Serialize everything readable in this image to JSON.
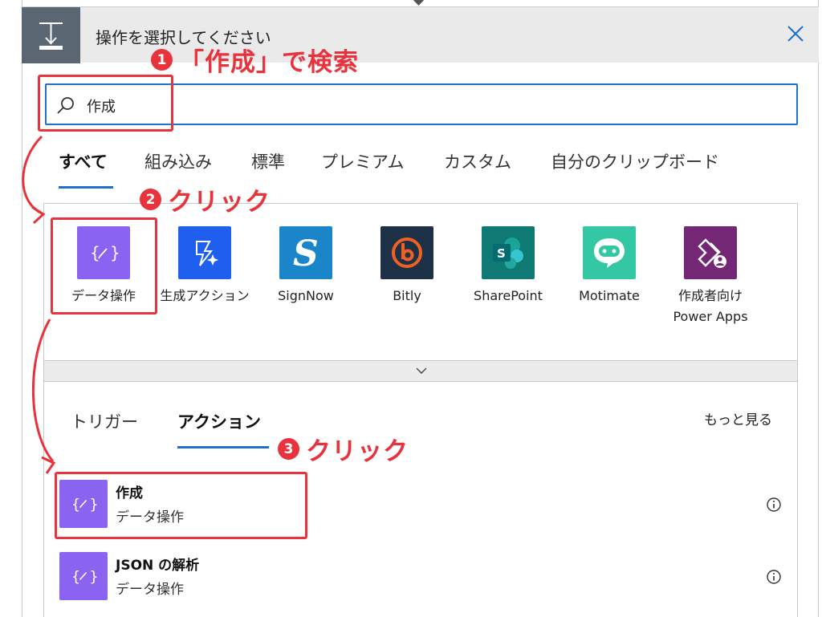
{
  "header": {
    "title": "操作を選択してください"
  },
  "search": {
    "value": "作成"
  },
  "tabs": [
    "すべて",
    "組み込み",
    "標準",
    "プレミアム",
    "カスタム",
    "自分のクリップボード"
  ],
  "connectors": [
    {
      "label": "データ操作",
      "color": "#8a63f0",
      "icon": "data-operation-icon"
    },
    {
      "label": "生成アクション",
      "color": "#1e5ff0",
      "icon": "generate-action-icon"
    },
    {
      "label": "SignNow",
      "color": "#1a86c9",
      "icon": "signnow-icon"
    },
    {
      "label": "Bitly",
      "color": "#1e3045",
      "icon": "bitly-icon"
    },
    {
      "label": "SharePoint",
      "color": "#0e7a73",
      "icon": "sharepoint-icon"
    },
    {
      "label": "Motimate",
      "color": "#33c7a4",
      "icon": "motimate-icon"
    },
    {
      "label": "作成者向け Power Apps",
      "color": "#742774",
      "icon": "power-apps-icon"
    }
  ],
  "subtabs": {
    "trigger": "トリガー",
    "action": "アクション",
    "more": "もっと見る"
  },
  "actions": [
    {
      "name": "作成",
      "connector": "データ操作"
    },
    {
      "name": "JSON の解析",
      "connector": "データ操作"
    }
  ],
  "annotations": {
    "step1": {
      "number": "1",
      "text": "「作成」で検索"
    },
    "step2": {
      "number": "2",
      "text": "クリック"
    },
    "step3": {
      "number": "3",
      "text": "クリック"
    }
  },
  "colors": {
    "accent": "#1f6fd1",
    "annotation": "#e8323c",
    "data_tile": "#8a63f0",
    "header_icon_bg": "#5a6772"
  }
}
